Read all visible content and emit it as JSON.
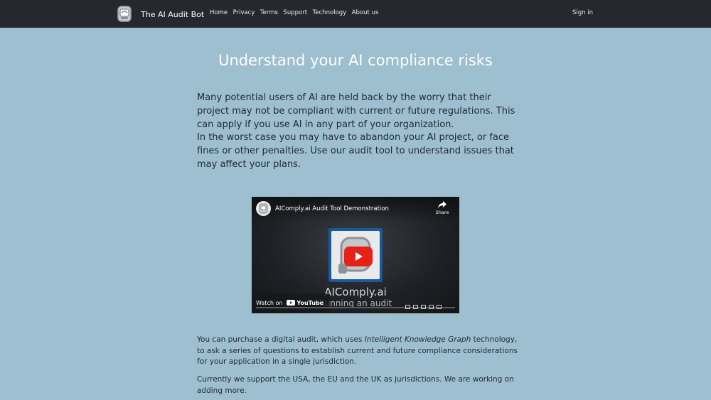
{
  "nav": {
    "brand": "The AI Audit Bot",
    "links": [
      "Home",
      "Privacy",
      "Terms",
      "Support",
      "Technology",
      "About us"
    ],
    "signin": "Sign in",
    "icons": [
      "robot-logo-icon"
    ]
  },
  "hero": {
    "headline": "Understand your AI compliance risks",
    "intro_line1": "Many potential users of AI are held back by the worry that their project may not be compliant with current or future regulations. This can apply if you use AI in any part of your organization.",
    "intro_line2": "In the worst case you may have to abandon your AI project, or face fines or other penalties. Use our audit tool to understand issues that may affect your plans."
  },
  "video": {
    "title": "AIComply.ai Audit Tool Demonstration",
    "share": "Share",
    "brand_text": "AIComply.ai",
    "sub_text": "Running an audit",
    "watch_on": "Watch on",
    "youtube": "YouTube",
    "play_color": "#e62117",
    "icons": [
      "channel-avatar-icon",
      "share-icon",
      "play-icon",
      "youtube-icon"
    ]
  },
  "content": {
    "p1_before": "You can purchase a digital audit, which uses ",
    "p1_em": "Intelligent Knowledge Graph",
    "p1_after": " technology, to ask a series of questions to establish current and future compliance considerations for your application in a single jurisdiction.",
    "p2": "Currently we support the USA, the EU and the UK as jurisdictions. We are working on adding more."
  },
  "colors": {
    "nav_bg": "#25292e",
    "page_bg": "#9dbfcf",
    "headline": "#ffffff",
    "text": "#1f2a33"
  }
}
